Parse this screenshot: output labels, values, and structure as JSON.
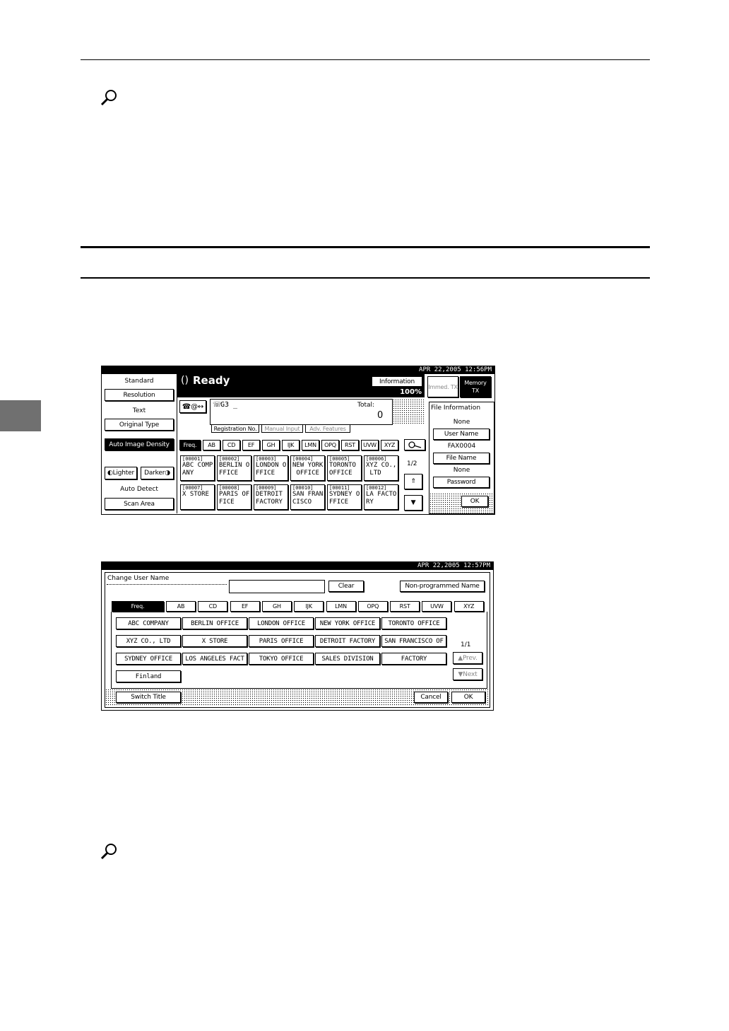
{
  "panel1": {
    "datetime": "APR   22,2005 12:56PM",
    "status": "Ready",
    "information_btn": "Information",
    "percent": "100%",
    "immed_tx": "Immed. TX",
    "memory_tx": "Memory TX",
    "left": {
      "standard": "Standard",
      "resolution": "Resolution",
      "text": "Text",
      "original_type": "Original Type",
      "auto_image_density": "Auto Image Density",
      "lighter": "Lighter",
      "darker": "Darker",
      "auto_detect": "Auto Detect",
      "scan_area": "Scan Area"
    },
    "dest_input": "G3 _",
    "total_label": "Total:",
    "total_value": "0",
    "subtabs": [
      "Registration No.",
      "Manual Input",
      "Adv. Features"
    ],
    "title_tabs": [
      "Freq.",
      "AB",
      "CD",
      "EF",
      "GH",
      "IJK",
      "LMN",
      "OPQ",
      "RST",
      "UVW",
      "XYZ"
    ],
    "page": "1/2",
    "destinations": [
      {
        "code": "[00001]",
        "line1": "ABC COMP",
        "line2": "ANY"
      },
      {
        "code": "[00002]",
        "line1": "BERLIN O",
        "line2": "FFICE"
      },
      {
        "code": "[00003]",
        "line1": "LONDON O",
        "line2": "FFICE"
      },
      {
        "code": "[00004]",
        "line1": "NEW YORK",
        "line2": " OFFICE"
      },
      {
        "code": "[00005]",
        "line1": "TORONTO",
        "line2": "OFFICE"
      },
      {
        "code": "[00006]",
        "line1": "XYZ CO.,",
        "line2": " LTD"
      },
      {
        "code": "[00007]",
        "line1": "X STORE",
        "line2": ""
      },
      {
        "code": "[00008]",
        "line1": "PARIS OF",
        "line2": "FICE"
      },
      {
        "code": "[00009]",
        "line1": "DETROIT",
        "line2": "FACTORY"
      },
      {
        "code": "[00010]",
        "line1": "SAN FRAN",
        "line2": "CISCO"
      },
      {
        "code": "[00011]",
        "line1": "SYDNEY O",
        "line2": "FFICE"
      },
      {
        "code": "[00012]",
        "line1": "LA FACTO",
        "line2": "RY"
      }
    ],
    "file_info": {
      "title": "File Information",
      "none1": "None",
      "user_name": "User Name",
      "fax_id": "FAX0004",
      "file_name": "File Name",
      "none2": "None",
      "password": "Password",
      "ok": "OK"
    }
  },
  "panel2": {
    "datetime": "APR   22,2005 12:57PM",
    "title": "Change User Name",
    "clear": "Clear",
    "non_programmed": "Non-programmed Name",
    "tabs": [
      "Freq.",
      "AB",
      "CD",
      "EF",
      "GH",
      "IJK",
      "LMN",
      "OPQ",
      "RST",
      "UVW",
      "XYZ"
    ],
    "names": [
      [
        "ABC COMPANY",
        "BERLIN OFFICE",
        "LONDON OFFICE",
        "NEW YORK OFFICE",
        "TORONTO OFFICE"
      ],
      [
        "XYZ CO., LTD",
        "X STORE",
        "PARIS OFFICE",
        "DETROIT FACTORY",
        "SAN FRANCISCO OF"
      ],
      [
        "SYDNEY OFFICE",
        "LOS ANGELES FACT",
        "TOKYO OFFICE",
        "SALES DIVISION",
        "FACTORY"
      ],
      [
        "Finland"
      ]
    ],
    "page": "1/1",
    "prev": "Prev.",
    "next": "Next",
    "switch_title": "Switch Title",
    "cancel": "Cancel",
    "ok": "OK"
  }
}
